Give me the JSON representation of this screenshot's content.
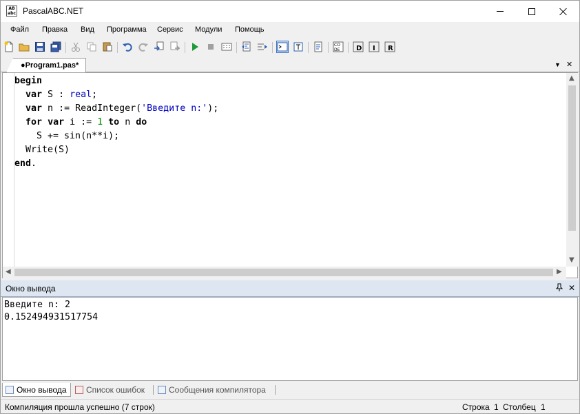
{
  "window": {
    "title": "PascalABC.NET",
    "icon_text": "AB\nabc"
  },
  "menu": [
    "Файл",
    "Правка",
    "Вид",
    "Программа",
    "Сервис",
    "Модули",
    "Помощь"
  ],
  "toolbar_icons": [
    "new-file",
    "open-folder",
    "save",
    "save-all",
    "cut",
    "copy",
    "paste",
    "undo",
    "redo",
    "find",
    "replace",
    "run",
    "stop",
    "debug",
    "format-code",
    "navigate",
    "output-window",
    "text-window",
    "single-file",
    "designer",
    "insert-code",
    "insert-template",
    "insert-r"
  ],
  "doc_tab": {
    "label": "●Program1.pas*",
    "dropdown": "▼",
    "close": "✕"
  },
  "code": {
    "lines": [
      [
        {
          "t": "begin",
          "c": "kw"
        }
      ],
      [
        {
          "t": "  "
        },
        {
          "t": "var",
          "c": "kw"
        },
        {
          "t": " S : "
        },
        {
          "t": "real",
          "c": "ty"
        },
        {
          "t": ";"
        }
      ],
      [
        {
          "t": "  "
        },
        {
          "t": "var",
          "c": "kw"
        },
        {
          "t": " n := ReadInteger("
        },
        {
          "t": "'Введите n:'",
          "c": "st"
        },
        {
          "t": ");"
        }
      ],
      [
        {
          "t": "  "
        },
        {
          "t": "for",
          "c": "kw"
        },
        {
          "t": " "
        },
        {
          "t": "var",
          "c": "kw"
        },
        {
          "t": " i := "
        },
        {
          "t": "1",
          "c": "nm"
        },
        {
          "t": " "
        },
        {
          "t": "to",
          "c": "kw"
        },
        {
          "t": " n "
        },
        {
          "t": "do",
          "c": "kw"
        }
      ],
      [
        {
          "t": "    S += sin(n**i);"
        }
      ],
      [
        {
          "t": "  Write(S)"
        }
      ],
      [
        {
          "t": "end",
          "c": "kw"
        },
        {
          "t": "."
        }
      ]
    ]
  },
  "output": {
    "title": "Окно вывода",
    "pin": "📌",
    "close": "✕",
    "text": "Введите n: 2\n0.152494931517754"
  },
  "bottom_tabs": [
    "Окно вывода",
    "Список ошибок",
    "Сообщения компилятора"
  ],
  "status": {
    "message": "Компиляция прошла успешно (7 строк)",
    "line_label": "Строка",
    "line": "1",
    "col_label": "Столбец",
    "col": "1"
  },
  "colors": {
    "keyword": "#000000",
    "type": "#0000c0",
    "string": "#0000c0",
    "number": "#009000",
    "panel_header": "#dde6f1"
  }
}
